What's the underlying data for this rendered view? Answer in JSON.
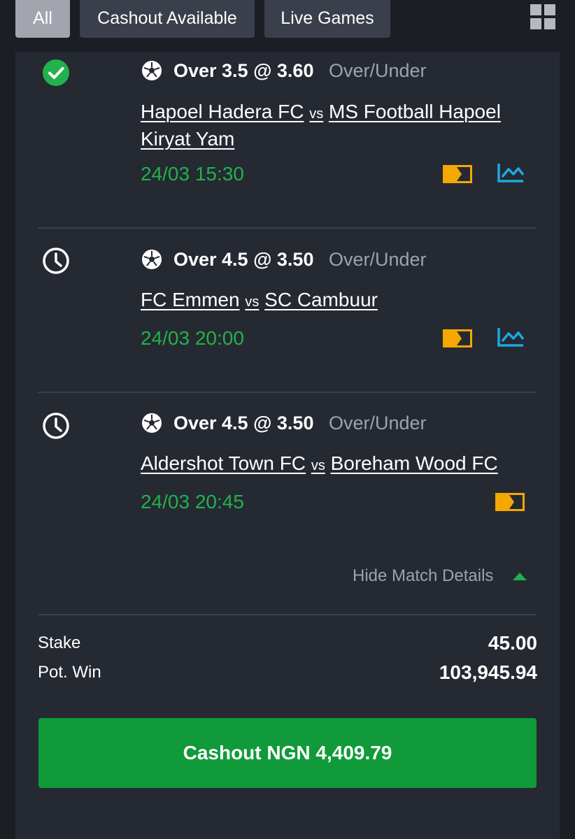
{
  "filters": {
    "tabs": [
      {
        "label": "All",
        "active": true
      },
      {
        "label": "Cashout Available",
        "active": false
      },
      {
        "label": "Live Games",
        "active": false
      }
    ],
    "layout_icon": "grid-icon"
  },
  "bets": [
    {
      "status": "won",
      "status_icon": "check-circle-icon",
      "sport_icon": "soccer-ball-icon",
      "pick": "Over 3.5 @ 3.60",
      "market": "Over/Under",
      "home": "Hapoel Hadera FC",
      "vs": "vs",
      "away": "MS Football Hapoel Kiryat Yam",
      "time": "24/03 15:30",
      "has_stats": true
    },
    {
      "status": "pending",
      "status_icon": "clock-icon",
      "sport_icon": "soccer-ball-icon",
      "pick": "Over 4.5 @ 3.50",
      "market": "Over/Under",
      "home": "FC Emmen",
      "vs": "vs",
      "away": "SC Cambuur",
      "time": "24/03 20:00",
      "has_stats": true
    },
    {
      "status": "pending",
      "status_icon": "clock-icon",
      "sport_icon": "soccer-ball-icon",
      "pick": "Over 4.5 @ 3.50",
      "market": "Over/Under",
      "home": "Aldershot Town FC",
      "vs": "vs",
      "away": "Boreham Wood FC",
      "time": "24/03 20:45",
      "has_stats": false
    }
  ],
  "details_toggle": "Hide Match Details",
  "summary": {
    "stake_label": "Stake",
    "stake_value": "45.00",
    "potwin_label": "Pot. Win",
    "potwin_value": "103,945.94"
  },
  "cashout_button": "Cashout NGN 4,409.79",
  "colors": {
    "accent_green": "#22b14c",
    "button_green": "#109a3a",
    "live_tv_yellow": "#f5a800",
    "stats_blue": "#1ea7e1"
  }
}
